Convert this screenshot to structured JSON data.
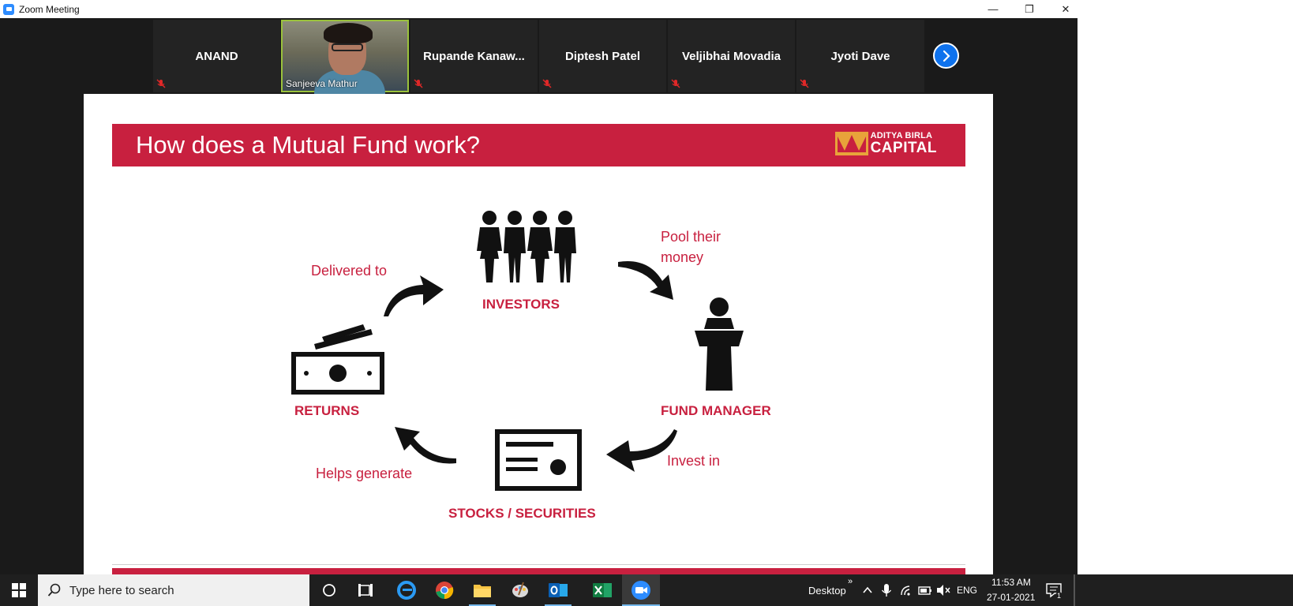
{
  "window": {
    "title": "Zoom Meeting",
    "minimize": "—",
    "maximize": "❐",
    "close": "✕"
  },
  "participants": [
    {
      "name": "ANAND",
      "muted": true,
      "video": false
    },
    {
      "name": "Sanjeeva Mathur",
      "muted": false,
      "video": true
    },
    {
      "name": "Rupande  Kanaw...",
      "muted": true,
      "video": false
    },
    {
      "name": "Diptesh Patel",
      "muted": true,
      "video": false
    },
    {
      "name": "Veljibhai Movadia",
      "muted": true,
      "video": false
    },
    {
      "name": "Jyoti Dave",
      "muted": true,
      "video": false
    }
  ],
  "next_page_icon": "chevron-right-icon",
  "slide": {
    "title": "How does a Mutual Fund work?",
    "logo_line1": "ADITYA BIRLA",
    "logo_line2": "CAPITAL",
    "nodes": {
      "investors": "INVESTORS",
      "fund_manager": "FUND MANAGER",
      "stocks": "STOCKS / SECURITIES",
      "returns": "RETURNS"
    },
    "arrows": {
      "pool": "Pool their money",
      "pool_line1": "Pool their",
      "pool_line2": "money",
      "invest": "Invest in",
      "helps": "Helps generate",
      "delivered": "Delivered to"
    },
    "accent_color": "#c8203f"
  },
  "taskbar": {
    "search_placeholder": "Type here to search",
    "desktop_label": "Desktop",
    "language": "ENG",
    "time": "11:53 AM",
    "date": "27-01-2021",
    "notification_count": "1",
    "apps": [
      "task-view",
      "edge",
      "chrome",
      "file-explorer",
      "paint",
      "outlook",
      "excel",
      "zoom"
    ]
  }
}
